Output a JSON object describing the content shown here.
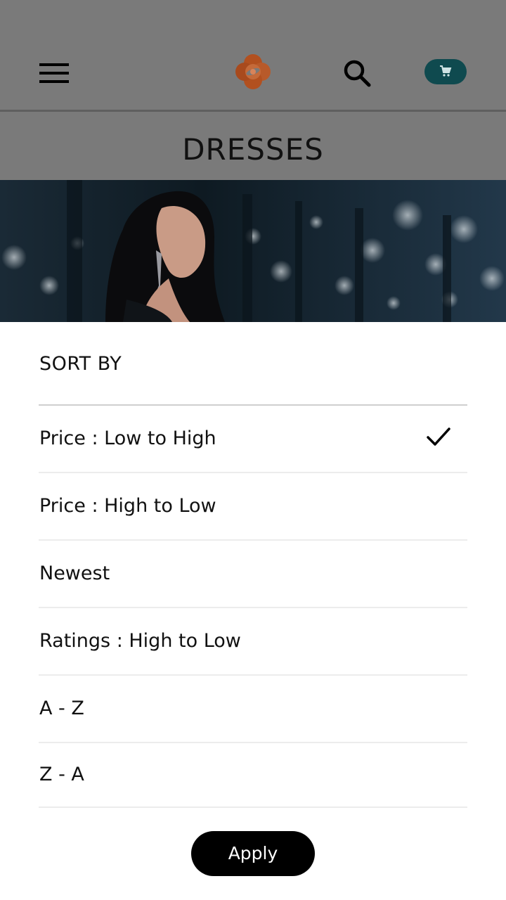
{
  "header": {
    "menu_icon": "hamburger-menu-icon",
    "logo": "brand-flower-logo",
    "search_icon": "search-icon",
    "cart_icon": "cart-icon",
    "cart_color": "#0f4a4f"
  },
  "category": {
    "title": "DRESSES"
  },
  "banner": {
    "description_icon": "category-banner-image"
  },
  "sort_sheet": {
    "title": "SORT BY",
    "options": [
      {
        "label": "Price : Low to High",
        "selected": true
      },
      {
        "label": "Price : High to Low",
        "selected": false
      },
      {
        "label": "Newest",
        "selected": false
      },
      {
        "label": "Ratings : High to Low",
        "selected": false
      },
      {
        "label": "A - Z",
        "selected": false
      },
      {
        "label": "Z - A",
        "selected": false
      }
    ],
    "selected_icon": "checkmark-icon",
    "apply_label": "Apply"
  }
}
